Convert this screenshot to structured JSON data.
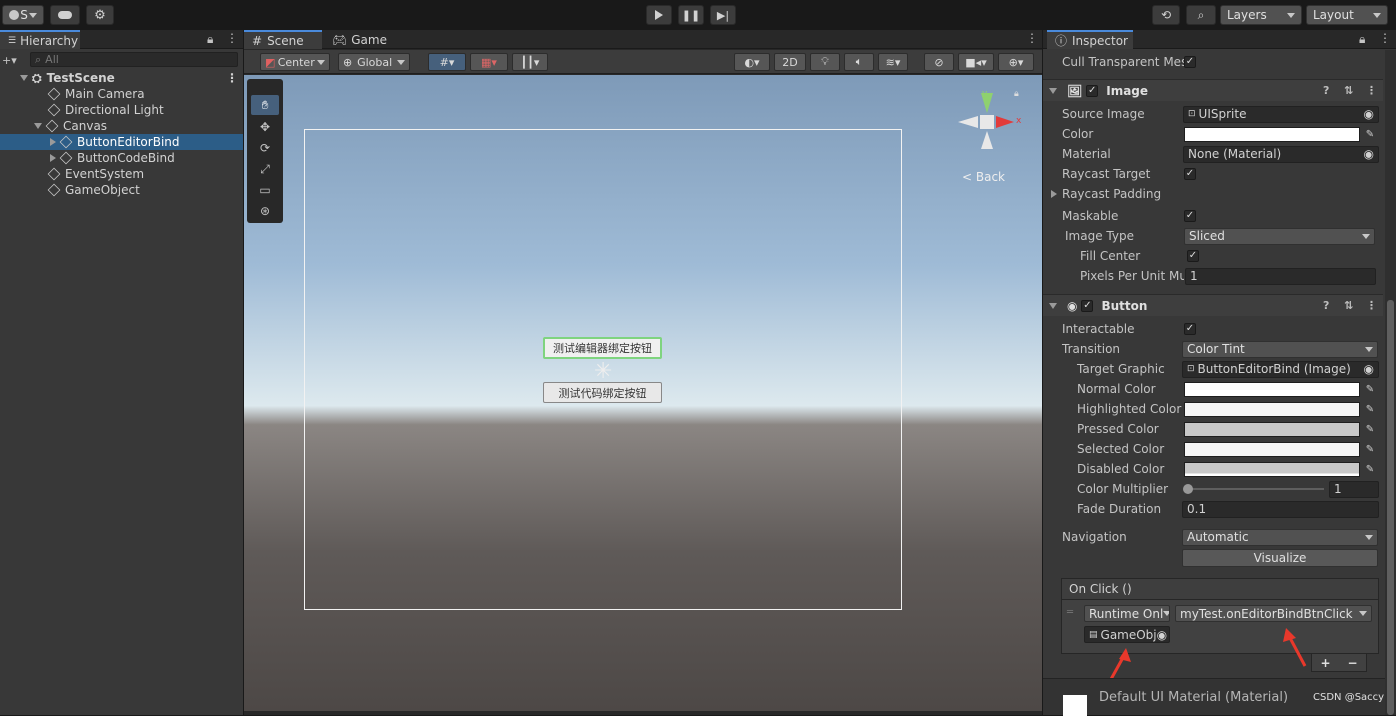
{
  "toolbar": {
    "account_label": "S",
    "layers_label": "Layers",
    "layout_label": "Layout"
  },
  "hierarchy": {
    "tab": "Hierarchy",
    "search_placeholder": "All",
    "scene_name": "TestScene",
    "items": [
      {
        "label": "Main Camera"
      },
      {
        "label": "Directional Light"
      },
      {
        "label": "Canvas"
      },
      {
        "label": "ButtonEditorBind"
      },
      {
        "label": "ButtonCodeBind"
      },
      {
        "label": "EventSystem"
      },
      {
        "label": "GameObject"
      }
    ]
  },
  "scene": {
    "tabs": [
      "Scene",
      "Game"
    ],
    "pivot_label": "Center",
    "space_label": "Global",
    "mode_2d": "2D",
    "gizmo_back": "Back",
    "button_editor_text": "测试编辑器绑定按钮",
    "button_code_text": "测试代码绑定按钮"
  },
  "inspector": {
    "tab": "Inspector",
    "cull_label": "Cull Transparent Mes",
    "image": {
      "title": "Image",
      "source_image_label": "Source Image",
      "source_image_value": "UISprite",
      "color_label": "Color",
      "material_label": "Material",
      "material_value": "None (Material)",
      "raycast_target_label": "Raycast Target",
      "raycast_padding_label": "Raycast Padding",
      "maskable_label": "Maskable",
      "image_type_label": "Image Type",
      "image_type_value": "Sliced",
      "fill_center_label": "Fill Center",
      "ppu_label": "Pixels Per Unit Mul",
      "ppu_value": "1"
    },
    "button": {
      "title": "Button",
      "interactable_label": "Interactable",
      "transition_label": "Transition",
      "transition_value": "Color Tint",
      "target_graphic_label": "Target Graphic",
      "target_graphic_value": "ButtonEditorBind (Image)",
      "normal_color_label": "Normal Color",
      "highlighted_color_label": "Highlighted Color",
      "pressed_color_label": "Pressed Color",
      "selected_color_label": "Selected Color",
      "disabled_color_label": "Disabled Color",
      "color_multiplier_label": "Color Multiplier",
      "color_multiplier_value": "1",
      "fade_duration_label": "Fade Duration",
      "fade_duration_value": "0.1",
      "navigation_label": "Navigation",
      "navigation_value": "Automatic",
      "visualize_label": "Visualize",
      "onclick_label": "On Click ()",
      "runtime_value": "Runtime Onl",
      "method_value": "myTest.onEditorBindBtnClick",
      "object_value": "GameObj",
      "plus": "+",
      "minus": "−"
    },
    "footer_material": "Default UI Material (Material)",
    "watermark": "CSDN @Saccy"
  },
  "colors": {
    "accent": "#4a8adb",
    "selection": "#2c5d87",
    "normal": "#ffffff",
    "highlighted": "#f5f5f5",
    "pressed": "#c8c8c8",
    "selected": "#f5f5f5",
    "disabled": "#c8c8c8"
  }
}
